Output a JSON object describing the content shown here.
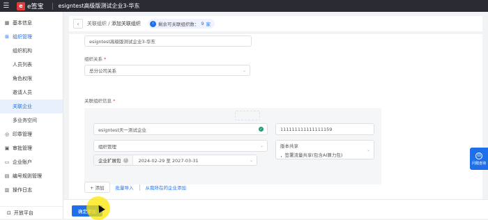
{
  "topbar": {
    "logo_mark": "e",
    "logo_text": "e签宝",
    "org_name": "esigntest高级版测试企业3-华东"
  },
  "sidebar": {
    "items": [
      {
        "label": "基本信息",
        "icon": "building-icon"
      },
      {
        "label": "组织管理",
        "icon": "org-icon",
        "expanded": true
      },
      {
        "label": "组织机构",
        "sub": true
      },
      {
        "label": "人员列表",
        "sub": true
      },
      {
        "label": "角色权限",
        "sub": true
      },
      {
        "label": "邀请人员",
        "sub": true
      },
      {
        "label": "关联企业",
        "sub": true,
        "active": true
      },
      {
        "label": "多业务空间",
        "sub": true
      },
      {
        "label": "印章管理",
        "icon": "seal-icon"
      },
      {
        "label": "审批管理",
        "icon": "approval-icon"
      },
      {
        "label": "企业账户",
        "icon": "wallet-icon"
      },
      {
        "label": "编号规则管理",
        "icon": "numbering-icon"
      },
      {
        "label": "操作日志",
        "icon": "log-icon"
      }
    ],
    "footer": "开放平台"
  },
  "breadcrumb": {
    "parent": "关联组织",
    "separator": "/",
    "current": "添加关联组织"
  },
  "quota": {
    "label": "剩余可关联组织数：",
    "count": "9",
    "unit": "家"
  },
  "form": {
    "org_name_value": "esigntest高级版测试企业3-华东",
    "relation_label": "组织关系",
    "relation_value": "总分公司关系",
    "related_info_label": "关联组织信息",
    "required_mark": "*",
    "related_org_name": "esigntest天一测试企业",
    "related_org_code": "111111111111111159",
    "role_value": "组织管理",
    "edition_line1": "版本共享",
    "edition_line2": "，签署流量共享(包含AI算力包)",
    "package_label": "企业扩展包",
    "package_range": "2024-02-29 至 2027-03-31"
  },
  "actions": {
    "add": "+ 添加",
    "bulk_import": "批量导入",
    "add_from_org": "从我所在的企业添加"
  },
  "footer": {
    "confirm": "确定添加"
  },
  "help": {
    "label": "问题咨询"
  },
  "colors": {
    "primary": "#1f6feb",
    "topbar": "#2b2b33",
    "brand": "#e4393c",
    "success": "#22a06b"
  }
}
